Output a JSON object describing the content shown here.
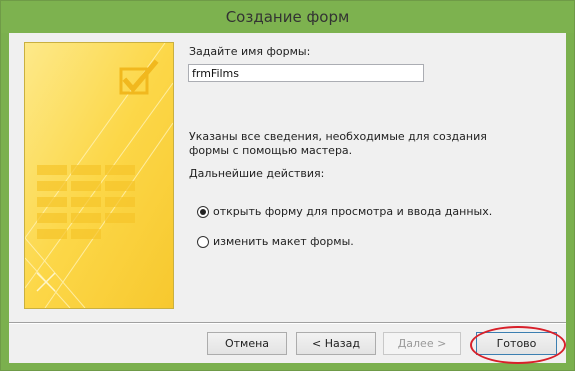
{
  "window": {
    "title": "Создание форм",
    "titlebar_color": "#7db24f"
  },
  "form": {
    "name_label": "Задайте имя формы:",
    "name_value": "frmFilms",
    "info_text": "Указаны все сведения, необходимые для создания формы с помощью мастера.",
    "next_actions_label": "Дальнейшие действия:"
  },
  "options": [
    {
      "label": "открыть форму для просмотра и ввода данных.",
      "selected": true
    },
    {
      "label": "изменить макет формы.",
      "selected": false
    }
  ],
  "buttons": {
    "cancel": "Отмена",
    "back": "< Назад",
    "next": "Далее >",
    "finish": "Готово"
  },
  "colors": {
    "wizard_art": "#fcd84a",
    "annotation": "#d8202a"
  },
  "icons": {
    "wizard_art": "wizard-illustration-icon"
  }
}
